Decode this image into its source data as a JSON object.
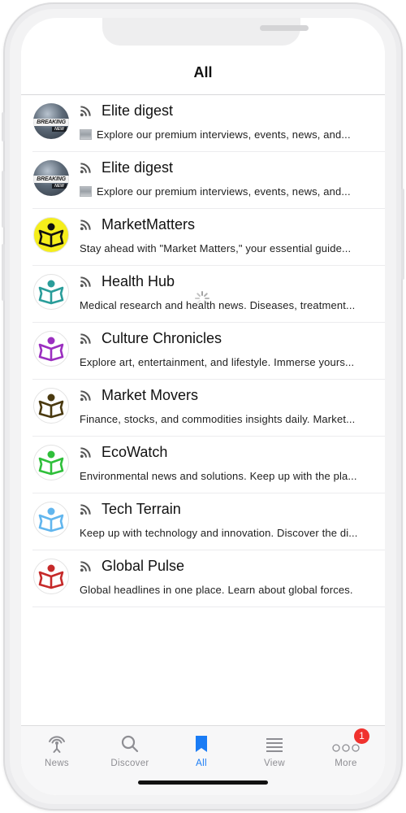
{
  "header": {
    "title": "All"
  },
  "feeds": [
    {
      "title": "Elite digest",
      "description": "Explore our premium interviews, events, news, and...",
      "avatar": "breaking-news",
      "has_thumbnail": true
    },
    {
      "title": "Elite digest",
      "description": "Explore our premium interviews, events, news, and...",
      "avatar": "breaking-news",
      "has_thumbnail": true
    },
    {
      "title": "MarketMatters",
      "description": "Stay ahead with \"Market Matters,\"  your essential guide...",
      "avatar": "reader-icon",
      "icon_color": "#111111",
      "bg_color": "#f5ee1b",
      "has_thumbnail": false
    },
    {
      "title": "Health Hub",
      "description": "Medical research and health news. Diseases, treatment...",
      "avatar": "reader-icon",
      "icon_color": "#2a9d9a",
      "bg_color": "#ffffff",
      "has_thumbnail": false
    },
    {
      "title": "Culture Chronicles",
      "description": "Explore art, entertainment, and lifestyle. Immerse yours...",
      "avatar": "reader-icon",
      "icon_color": "#9b2fc0",
      "bg_color": "#ffffff",
      "has_thumbnail": false
    },
    {
      "title": "Market Movers",
      "description": "Finance, stocks, and commodities insights daily. Market...",
      "avatar": "reader-icon",
      "icon_color": "#4a3a10",
      "bg_color": "#ffffff",
      "has_thumbnail": false
    },
    {
      "title": "EcoWatch",
      "description": "Environmental news and solutions. Keep up with the pla...",
      "avatar": "reader-icon",
      "icon_color": "#2fbf3a",
      "bg_color": "#ffffff",
      "has_thumbnail": false
    },
    {
      "title": "Tech Terrain",
      "description": "Keep up with technology and innovation. Discover the di...",
      "avatar": "reader-icon",
      "icon_color": "#62b6ee",
      "bg_color": "#ffffff",
      "has_thumbnail": false
    },
    {
      "title": "Global Pulse",
      "description": "Global headlines in one place. Learn about global forces.",
      "avatar": "reader-icon",
      "icon_color": "#c62a2a",
      "bg_color": "#ffffff",
      "has_thumbnail": false
    }
  ],
  "breaking_avatar": {
    "line1": "BREAKING",
    "line2": "NEW"
  },
  "tabs": [
    {
      "label": "News",
      "icon": "antenna-icon",
      "active": false
    },
    {
      "label": "Discover",
      "icon": "search-icon",
      "active": false
    },
    {
      "label": "All",
      "icon": "bookmark-icon",
      "active": true
    },
    {
      "label": "View",
      "icon": "list-icon",
      "active": false
    },
    {
      "label": "More",
      "icon": "more-icon",
      "active": false,
      "badge": "1"
    }
  ],
  "colors": {
    "accent": "#1a7cf5",
    "inactive": "#8e8e93",
    "badge": "#f0322e"
  }
}
